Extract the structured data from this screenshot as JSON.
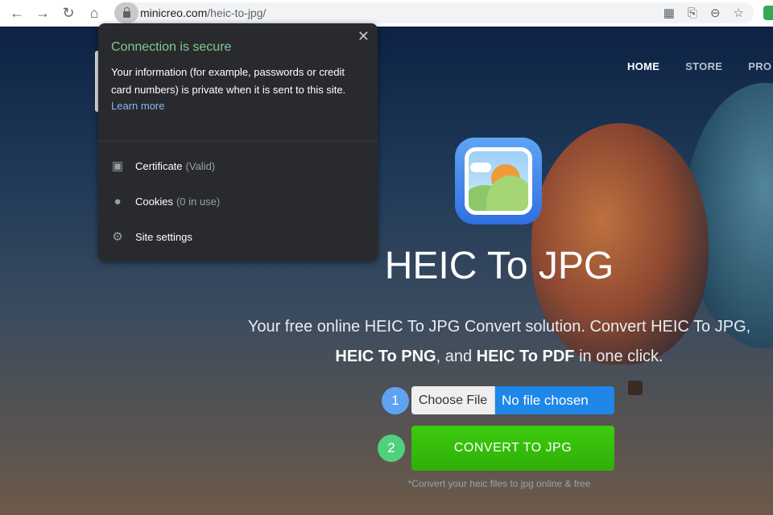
{
  "browser": {
    "url_domain": "minicreo.com",
    "url_path": "/heic-to-jpg/"
  },
  "site": {
    "nav": [
      "HOME",
      "STORE",
      "PRO"
    ],
    "title": "HEIC To JPG",
    "subtitle_parts": [
      "Your free online HEIC To JPG Convert solution. Convert HEIC To JPG, ",
      "HEIC To PNG",
      ", and ",
      "HEIC To PDF",
      " in one click."
    ],
    "steps": [
      "1",
      "2"
    ],
    "choose_file": "Choose File",
    "no_file": "No file chosen",
    "convert": "CONVERT TO JPG",
    "note": "*Convert your heic files to jpg online & free"
  },
  "popup": {
    "title": "Connection is secure",
    "description": "Your information (for example, passwords or credit card numbers) is private when it is sent to this site.",
    "learn_more": "Learn more",
    "items": [
      {
        "label": "Certificate",
        "status": "(Valid)"
      },
      {
        "label": "Cookies",
        "status": "(0 in use)"
      },
      {
        "label": "Site settings",
        "status": ""
      }
    ]
  },
  "colors": {
    "secure": "#81c995",
    "convert": "#33b80a",
    "file": "#1f87e8"
  }
}
